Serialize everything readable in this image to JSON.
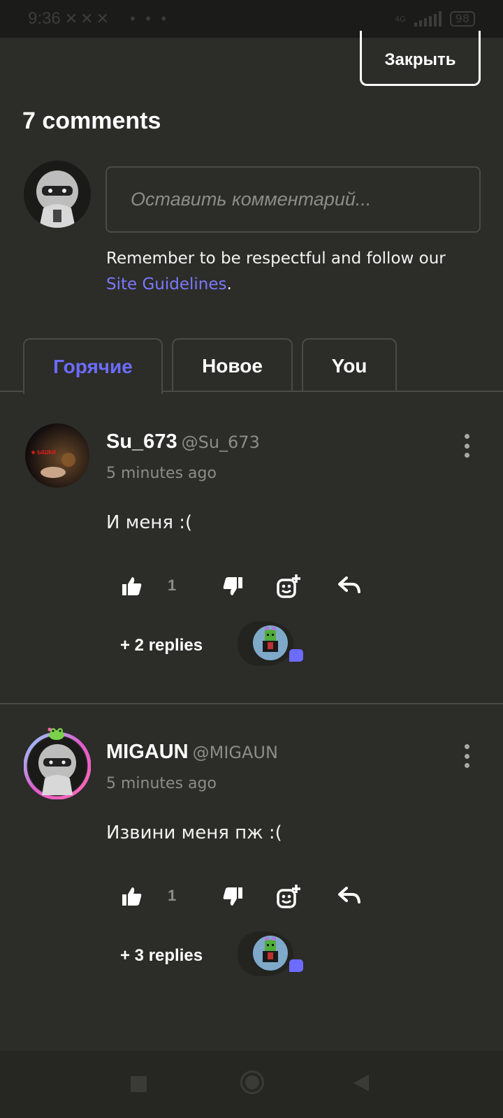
{
  "status": {
    "time": "9:36",
    "network": "4G",
    "battery": "98"
  },
  "close_label": "Закрыть",
  "title": "7 comments",
  "input": {
    "placeholder": "Оставить комментарий..."
  },
  "guidelines": {
    "text": "Remember to be respectful and follow our",
    "link": "Site Guidelines",
    "end": "."
  },
  "tabs": [
    {
      "label": "Горячие",
      "active": true
    },
    {
      "label": "Новое",
      "active": false
    },
    {
      "label": "You",
      "active": false
    }
  ],
  "comments": [
    {
      "name": "Su_673",
      "handle": "@Su_673",
      "time": "5 minutes ago",
      "text": "И меня :(",
      "likes": "1",
      "replies": "+ 2 replies"
    },
    {
      "name": "MIGAUN",
      "handle": "@MIGAUN",
      "time": "5 minutes ago",
      "text": "Извини меня пж :(",
      "likes": "1",
      "replies": "+ 3 replies"
    }
  ],
  "colors": {
    "accent": "#6c6cff",
    "background": "#2c2c28"
  },
  "icons": [
    "like-icon",
    "dislike-icon",
    "add-reaction-icon",
    "reply-icon",
    "more-options-icon"
  ]
}
